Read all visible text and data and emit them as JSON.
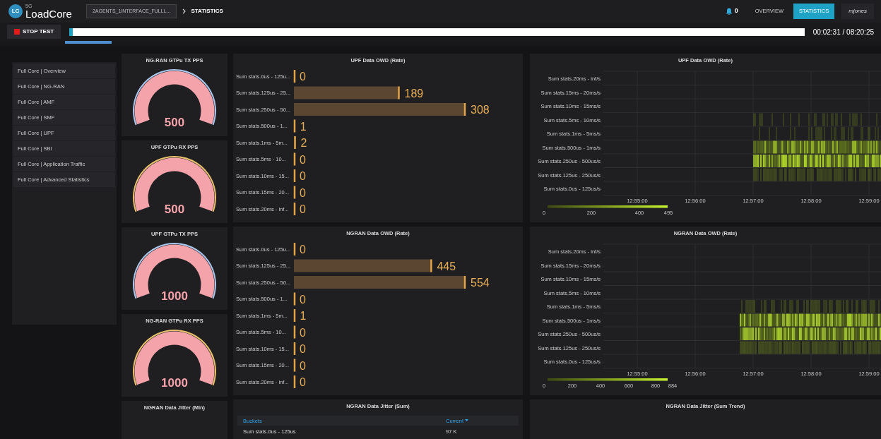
{
  "header": {
    "logo_badge": "LC",
    "logo_superscript": "5G",
    "logo_text": "LoadCore",
    "breadcrumb": [
      {
        "label": "2AGENTS_1INTERFACE_FULLL..."
      },
      {
        "label": "STATISTICS"
      }
    ],
    "notifications": "0",
    "nav": [
      {
        "label": "OVERVIEW",
        "selected": false
      },
      {
        "label": "STATISTICS",
        "selected": true
      }
    ],
    "user": "mjones"
  },
  "test_bar": {
    "stop_button": "STOP TEST",
    "progress": {
      "level": 0.005
    },
    "time": "00:02:31 / 08:20:25"
  },
  "sidebar": {
    "items": [
      "Full Core | Overview",
      "Full Core | NG-RAN",
      "Full Core | AMF",
      "Full Core | SMF",
      "Full Core | UPF",
      "Full Core | SBI",
      "Full Core | Application Traffic",
      "Full Core | Advanced Statistics"
    ]
  },
  "gauges": [
    {
      "title": "NG-RAN GTPu TX PPS",
      "value": "500",
      "color": "#a9c6ec"
    },
    {
      "title": "UPF GTPu RX PPS",
      "value": "500",
      "color": "#e6c06a"
    },
    {
      "title": "UPF GTPu TX PPS",
      "value": "1000",
      "color": "#a9c6ec"
    },
    {
      "title": "NG-RAN GTPu RX PPS",
      "value": "1000",
      "color": "#e6c06a"
    }
  ],
  "bar_panels": [
    {
      "title": "UPF Data OWD (Rate)",
      "chart_data": {
        "type": "bar",
        "orientation": "horizontal",
        "data_labels": true,
        "categories": [
          "Sum stats.0us - 125u...",
          "Sum stats.125us - 25...",
          "Sum stats.250us - 50...",
          "Sum stats.500us - 1...",
          "Sum stats.1ms - 5m...",
          "Sum stats.5ms - 10...",
          "Sum stats.10ms - 15...",
          "Sum stats.15ms - 20...",
          "Sum stats.20ms - inf..."
        ],
        "values": [
          0,
          189,
          308,
          1,
          2,
          0,
          0,
          0,
          0
        ]
      }
    },
    {
      "title": "NGRAN Data OWD (Rate)",
      "chart_data": {
        "type": "bar",
        "orientation": "horizontal",
        "data_labels": true,
        "categories": [
          "Sum stats.0us - 125u...",
          "Sum stats.125us - 25...",
          "Sum stats.250us - 50...",
          "Sum stats.500us - 1...",
          "Sum stats.1ms - 5m...",
          "Sum stats.5ms - 10...",
          "Sum stats.10ms - 15...",
          "Sum stats.15ms - 20...",
          "Sum stats.20ms - inf..."
        ],
        "values": [
          0,
          445,
          554,
          0,
          1,
          0,
          0,
          0,
          0
        ]
      }
    }
  ],
  "heatmaps": [
    {
      "title": "UPF Data OWD (Rate)",
      "y_labels": [
        "Sum stats.20ms - inf/s",
        "Sum stats.15ms - 20ms/s",
        "Sum stats.10ms - 15ms/s",
        "Sum stats.5ms - 10ms/s",
        "Sum stats.1ms - 5ms/s",
        "Sum stats.500us - 1ms/s",
        "Sum stats.250us - 500us/s",
        "Sum stats.125us - 250us/s",
        "Sum stats.0us - 125us/s"
      ],
      "x_labels": [
        "12:55:00",
        "12:56:00",
        "12:57:00",
        "12:58:00",
        "12:59:00"
      ],
      "legend_labels": [
        "0",
        "200",
        "400",
        "495"
      ]
    },
    {
      "title": "NGRAN Data OWD (Rate)",
      "y_labels": [
        "Sum stats.20ms - inf/s",
        "Sum stats.15ms - 20ms/s",
        "Sum stats.10ms - 15ms/s",
        "Sum stats.5ms - 10ms/s",
        "Sum stats.1ms - 5ms/s",
        "Sum stats.500us - 1ms/s",
        "Sum stats.250us - 500us/s",
        "Sum stats.125us - 250us/s",
        "Sum stats.0us - 125us/s"
      ],
      "x_labels": [
        "12:55:00",
        "12:56:00",
        "12:57:00",
        "12:58:00",
        "12:59:00"
      ],
      "legend_labels": [
        "0",
        "200",
        "400",
        "600",
        "800",
        "884"
      ]
    }
  ],
  "bottom": {
    "gauge_panel": {
      "title": "NGRAN Data Jitter (Min)"
    },
    "table_panel": {
      "title": "NGRAN Data Jitter (Sum)",
      "columns": [
        "Buckets",
        "Current"
      ],
      "rows": [
        [
          "Sum stats.0us - 125us",
          "97 K"
        ]
      ]
    },
    "trend_panel": {
      "title": "NGRAN Data Jitter (Sum Trend)"
    }
  }
}
